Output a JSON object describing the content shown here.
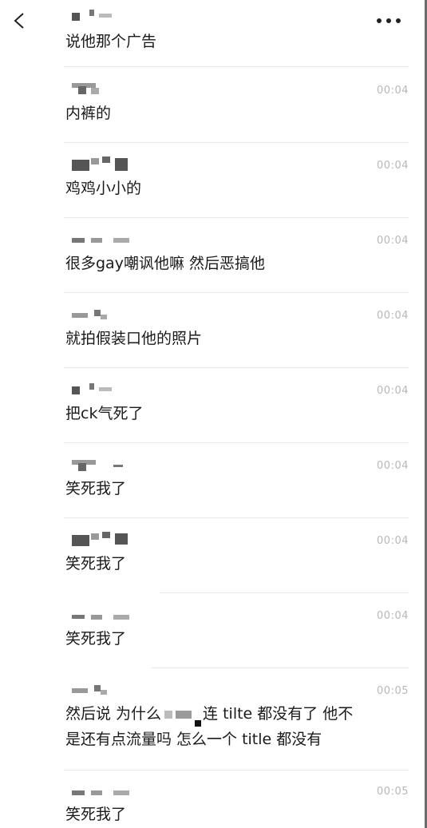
{
  "header": {
    "back_icon": "chevron-left-icon",
    "more_icon": "ellipsis-icon"
  },
  "messages": [
    {
      "time": "",
      "text": "说他那个广告"
    },
    {
      "time": "00:04",
      "text": "内裤的"
    },
    {
      "time": "00:04",
      "text": "鸡鸡小小的"
    },
    {
      "time": "00:04",
      "text": "很多gay嘲讽他嘛 然后恶搞他"
    },
    {
      "time": "00:04",
      "text": "就拍假装口他的照片"
    },
    {
      "time": "00:04",
      "text": "把ck气死了"
    },
    {
      "time": "00:04",
      "text": "笑死我了"
    },
    {
      "time": "00:04",
      "text": "笑死我了"
    },
    {
      "time": "00:04",
      "text": "笑死我了"
    },
    {
      "time": "00:05",
      "text_line1_a": "然后说 为什么",
      "text_line1_b": "连 tilte 都没有了 他不",
      "text_line2": "是还有点流量吗 怎么一个 title 都没有"
    },
    {
      "time": "00:05",
      "text": "笑死我了"
    }
  ]
}
